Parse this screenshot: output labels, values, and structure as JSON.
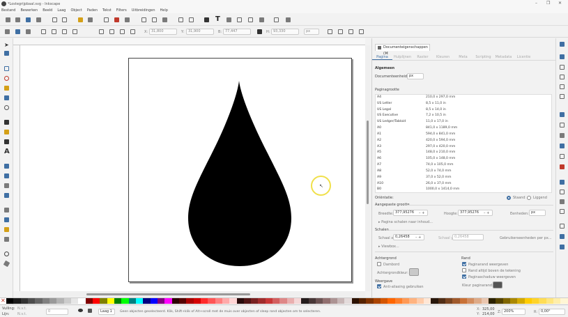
{
  "window": {
    "title": "*Lostegrijpbaal.svg - Inkscape",
    "controls": [
      "–",
      "❐",
      "✕"
    ]
  },
  "menu": [
    "Bestand",
    "Bewerken",
    "Beeld",
    "Laag",
    "Object",
    "Paden",
    "Tekst",
    "Filters",
    "Uitbreidingen",
    "Help"
  ],
  "tool_controls": {
    "x_label": "X:",
    "x_value": "31,800",
    "y_label": "Y:",
    "y_value": "31,900",
    "w_label": "B:",
    "w_value": "77,447",
    "h_label": "H:",
    "h_value": "93,330",
    "unit": "px"
  },
  "panel": {
    "tab_title": "Documenteigenschappen (⌘",
    "subtabs": [
      "Pagina",
      "Hulplijnen",
      "Raster",
      "Kleuren",
      "Meta",
      "Scripting",
      "Metadata",
      "Licentie"
    ],
    "algemeen": "Algemeen",
    "units_label": "Documenteenheid:",
    "units_value": "px",
    "page_size_label": "Paginagrootte",
    "sizes": [
      {
        "name": "A4",
        "value": "210,0 x 297,0 mm"
      },
      {
        "name": "US Letter",
        "value": "8,5 x 11,0 in"
      },
      {
        "name": "US Legal",
        "value": "8,5 x 14,0 in"
      },
      {
        "name": "US Executive",
        "value": "7,2 x 10,5 in"
      },
      {
        "name": "US Ledger/Tabloid",
        "value": "11,0 x 17,0 in"
      },
      {
        "name": "A0",
        "value": "841,0 x 1189,0 mm"
      },
      {
        "name": "A1",
        "value": "594,0 x 841,0 mm"
      },
      {
        "name": "A2",
        "value": "420,0 x 594,0 mm"
      },
      {
        "name": "A3",
        "value": "297,0 x 420,0 mm"
      },
      {
        "name": "A5",
        "value": "148,0 x 210,0 mm"
      },
      {
        "name": "A6",
        "value": "105,0 x 148,0 mm"
      },
      {
        "name": "A7",
        "value": "74,0 x 105,0 mm"
      },
      {
        "name": "A8",
        "value": "52,0 x 74,0 mm"
      },
      {
        "name": "A9",
        "value": "37,0 x 52,0 mm"
      },
      {
        "name": "A10",
        "value": "26,0 x 37,0 mm"
      },
      {
        "name": "B0",
        "value": "1000,0 x 1414,0 mm"
      }
    ],
    "orientation_label": "Oriëntatie:",
    "portrait": "Staand",
    "landscape": "Liggend",
    "custom_size_label": "Aangepaste grootte",
    "width_label": "Breedte:",
    "width_value": "377,95276",
    "height_label": "Hoogte:",
    "height_value": "377,95276",
    "units2_label": "Eenheden:",
    "units2_value": "px",
    "resize_label": "▸ Pagina schalen naar inhoud...",
    "scale_label": "Schalen",
    "scale_x_label": "Schaal x:",
    "scale_x_value": "0,26458",
    "scale_y_label": "Schaal y:",
    "scale_y_value": "0,26458",
    "user_units_label": "Gebruikerseenheden per px...",
    "viewbox_label": "▸ Viewbox...",
    "background_label": "Achtergrond",
    "checkerboard_label": "Dambord",
    "bgcolor_label": "Achtergrondkleur:",
    "border_label": "Rand",
    "border_show": "Paginarand weergeven",
    "border_top": "Rand altijd boven de tekening",
    "border_shadow": "Paginaschaduw weergeven",
    "border_color_label": "Kleur paginarand:",
    "display_label": "Weergave",
    "antialias_label": "Anti-aliasing gebruiken"
  },
  "status": {
    "fill_label": "Vulling:",
    "stroke_label": "Lijn:",
    "fill_value": "N.v.t.",
    "stroke_value": "N.v.t.",
    "opacity_value": "0",
    "layer": "Laag 1",
    "message": "Geen objecten geselecteerd. Klik, Shift+klik of Alt+scroll met de muis over objecten of sleep rond objecten om te selecteren.",
    "x_label": "X:",
    "x_value": "325,00",
    "y_label": "Y:",
    "y_value": "214,00",
    "zoom_label": "Z:",
    "zoom_value": "200%",
    "rotate_label": "R:",
    "rotate_value": "0,00°"
  },
  "colors": {
    "accent": "#3f6fa3",
    "highlight_circle": "#f0e04a",
    "drop": "#000000"
  }
}
